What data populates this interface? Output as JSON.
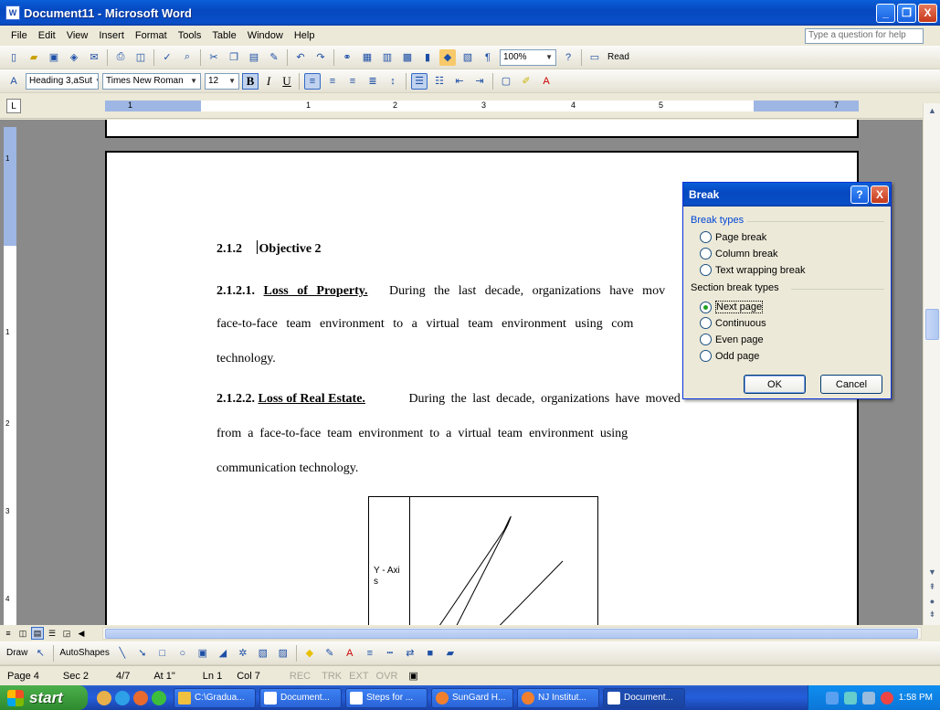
{
  "window": {
    "title": "Document11 - Microsoft Word",
    "minimize": "_",
    "restore": "❐",
    "close": "X"
  },
  "menu": {
    "items": [
      "File",
      "Edit",
      "View",
      "Insert",
      "Format",
      "Tools",
      "Table",
      "Window",
      "Help"
    ],
    "help_placeholder": "Type a question for help"
  },
  "standard_toolbar": {
    "zoom": "100%",
    "read_label": "Read"
  },
  "formatting_toolbar": {
    "style": "Heading 3,aSut",
    "font": "Times New Roman",
    "size": "12",
    "bold": "B",
    "italic": "I",
    "underline": "U"
  },
  "ruler": {
    "numbers": [
      "1",
      "1",
      "2",
      "3",
      "4",
      "5",
      "7"
    ]
  },
  "vruler": {
    "numbers": [
      "1",
      "1",
      "2",
      "3",
      "4"
    ]
  },
  "document": {
    "heading_num": "2.1.2",
    "heading_text": "Objective 2",
    "p1_num": "2.1.2.1.",
    "p1_title": "Loss of Property.",
    "p1_line1": "During the last decade, organizations have mov",
    "p1_line2": "face-to-face team environment to a virtual team environment using com",
    "p1_line3": "technology.",
    "p2_num": "2.1.2.2.",
    "p2_title": "Loss of Real Estate.",
    "p2_line1": "During the last decade, organizations have moved",
    "p2_line2": "from  a  face-to-face  team  environment  to  a  virtual  team  environment  using",
    "p2_line3": "communication technology.",
    "graph_ylabel": "Y - Axi s"
  },
  "dialog": {
    "title": "Break",
    "help": "?",
    "close": "X",
    "break_types_label": "Break types",
    "break_options": [
      "Page break",
      "Column break",
      "Text wrapping break"
    ],
    "section_label": "Section break types",
    "section_options": [
      "Next page",
      "Continuous",
      "Even page",
      "Odd page"
    ],
    "selected": "Next page",
    "ok": "OK",
    "cancel": "Cancel"
  },
  "draw_toolbar": {
    "draw": "Draw",
    "autoshapes": "AutoShapes"
  },
  "status": {
    "page": "Page 4",
    "sec": "Sec 2",
    "pages": "4/7",
    "at": "At 1\"",
    "ln": "Ln 1",
    "col": "Col 7",
    "rec": "REC",
    "trk": "TRK",
    "ext": "EXT",
    "ovr": "OVR"
  },
  "taskbar": {
    "start": "start",
    "tasks": [
      "C:\\Gradua...",
      "Document...",
      "Steps for ...",
      "SunGard H...",
      "NJ Institut...",
      "Document..."
    ],
    "clock": "1:58 PM"
  },
  "colors": {
    "titlebar": "#0548c0",
    "desktop_gray": "#8a8a8a",
    "dialog_group_label": "#0046d5"
  }
}
